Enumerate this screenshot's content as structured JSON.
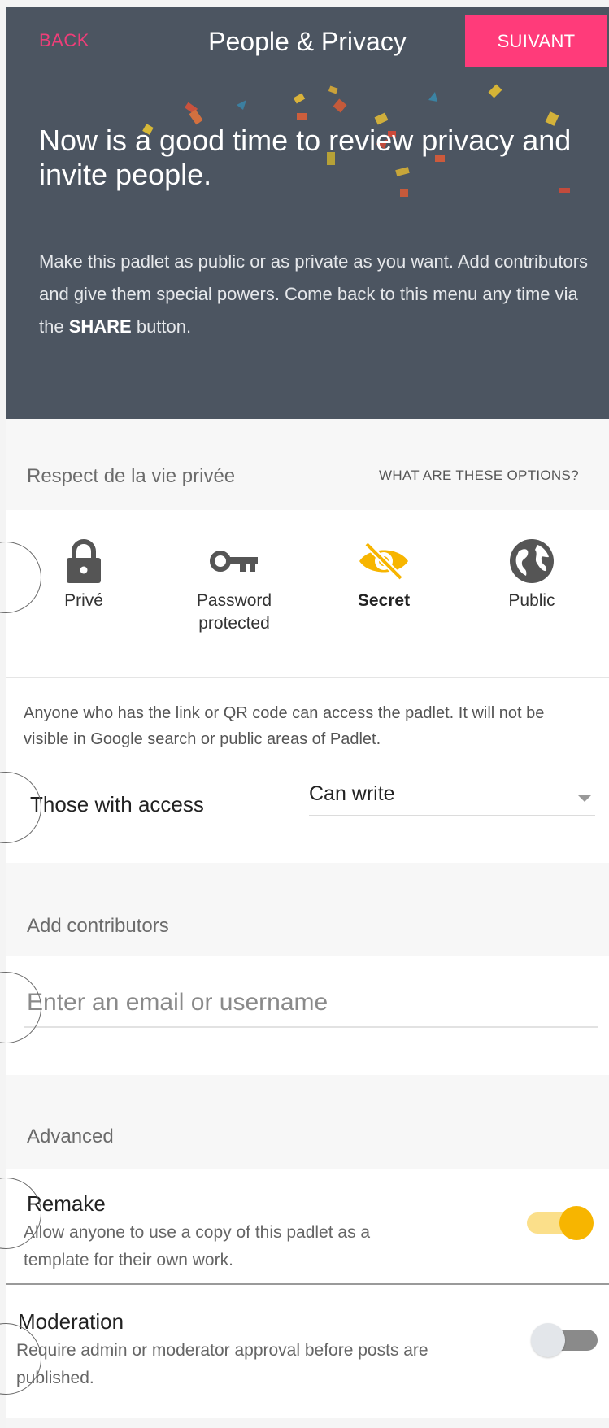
{
  "nav": {
    "back": "BACK",
    "title": "People & Privacy",
    "next": "SUIVANT"
  },
  "hero": {
    "title": "Now is a good time to review privacy and invite people.",
    "body_pre": "Make this padlet as public or as private as you want. Add contributors and give them special powers. Come back to this menu any time via the ",
    "body_bold": "SHARE",
    "body_post": " button."
  },
  "privacy": {
    "label": "Respect de la vie privée",
    "help_link": "WHAT ARE THESE OPTIONS?",
    "options": [
      {
        "label": "Privé",
        "icon": "lock-icon",
        "selected": false
      },
      {
        "label": "Password protected",
        "icon": "key-icon",
        "selected": false
      },
      {
        "label": "Secret",
        "icon": "eye-off-icon",
        "selected": true
      },
      {
        "label": "Public",
        "icon": "globe-icon",
        "selected": false
      }
    ],
    "description": "Anyone who has the link or QR code can access the padlet. It will not be visible in Google search or public areas of Padlet."
  },
  "access": {
    "label": "Those with access",
    "value": "Can write"
  },
  "contributors": {
    "label": "Add contributors",
    "placeholder": "Enter an email or username"
  },
  "advanced": {
    "label": "Advanced",
    "remake": {
      "title": "Remake",
      "description": "Allow anyone to use a copy of this padlet as a template for their own work.",
      "enabled": true
    },
    "moderation": {
      "title": "Moderation",
      "description": "Require admin or moderator approval before posts are published.",
      "enabled": false
    }
  },
  "markers": [
    "1",
    "2",
    "3",
    "4",
    "5"
  ],
  "colors": {
    "accent": "#ff3b7a",
    "header_bg": "#4c5561",
    "selected": "#f7b500"
  }
}
